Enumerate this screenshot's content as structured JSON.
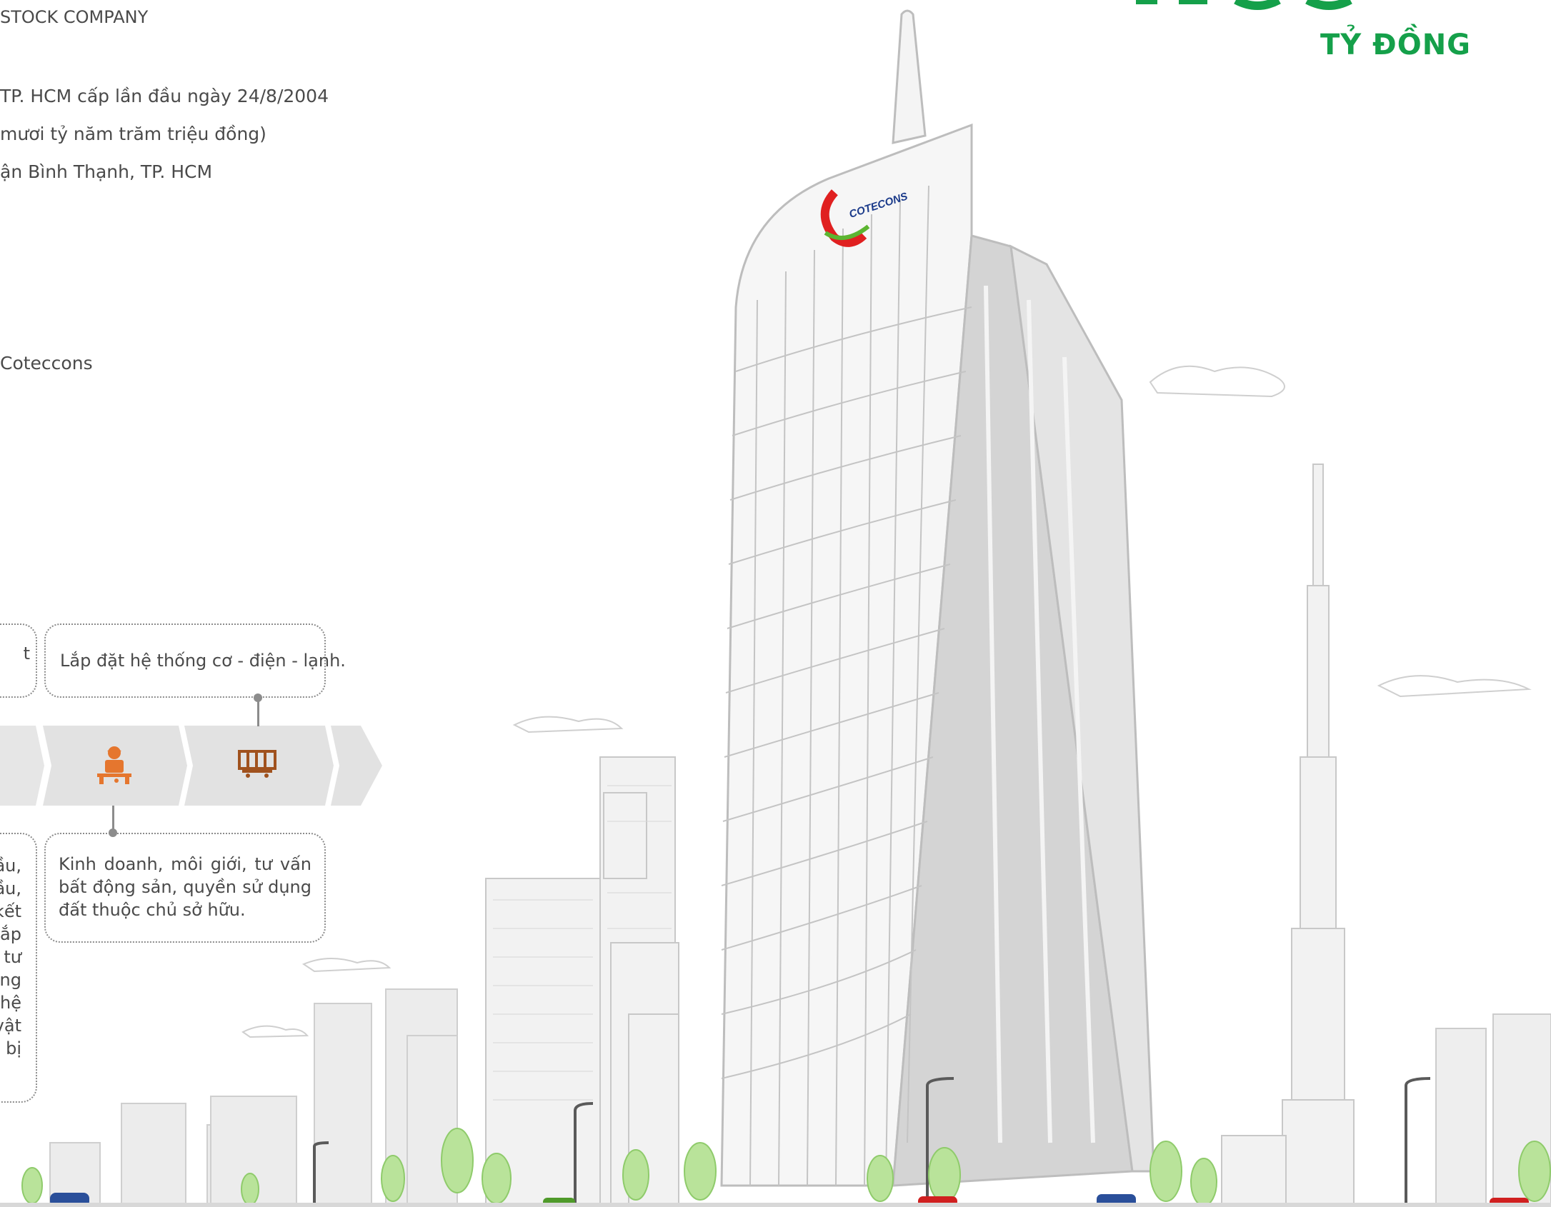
{
  "header": {
    "company_line": "STOCK COMPANY",
    "big_number_fragment": "",
    "unit": "TỶ ĐỒNG"
  },
  "info": {
    "license_line": "TP. HCM cấp lần đầu ngày 24/8/2004",
    "capital_line": "mươi tỷ năm trăm triệu đồng)",
    "address_line": "ận Bình Thạnh, TP. HCM",
    "brand_line": "Coteccons"
  },
  "business_flow": {
    "callout_top_left_text": "t",
    "callout_top_right_text": "Lắp đặt hệ thống cơ - điện - lạnh.",
    "callout_bottom_right_text": "Kinh doanh, môi giới, tư vấn bất động sản, quyền sử dụng đất thuộc chủ sở hữu.",
    "callout_bottom_left_line_ends": [
      "ầu,",
      "ầu,",
      "kết",
      "lắp",
      "tư",
      "ng",
      "hệ",
      "vật",
      "bị"
    ],
    "icons": [
      "worker-icon",
      "container-icon"
    ]
  },
  "building_logo": {
    "text": "COTECONS"
  },
  "colors": {
    "brand_green": "#15a04a",
    "text_gray": "#4a4a4a",
    "band_gray": "#e2e2e2",
    "icon_orange": "#e5762e",
    "icon_brown": "#a0521e",
    "logo_red": "#e02020",
    "logo_green": "#5cb531"
  }
}
